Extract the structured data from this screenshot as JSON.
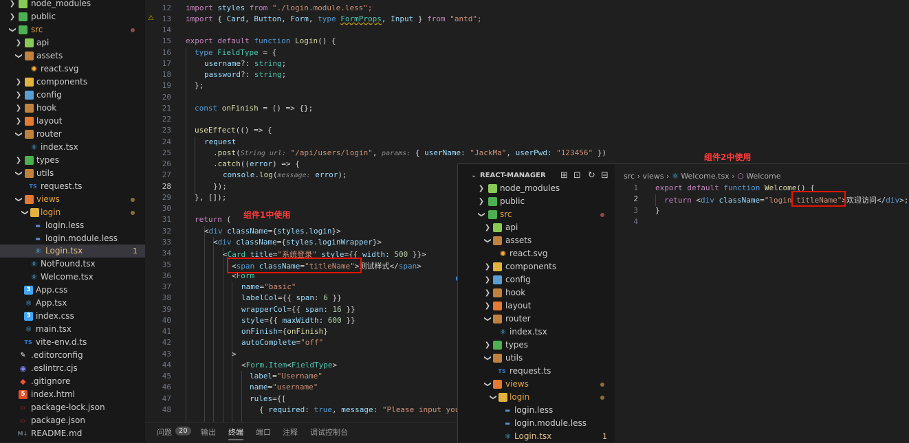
{
  "colors": {
    "folder_green": "#89c955",
    "folder_yellow": "#e2b23e",
    "folder_orange": "#e37933",
    "react_blue": "#4fc1ff",
    "ts_blue": "#3178c6",
    "css_blue": "#42a5f5",
    "modified_dot": "#8a6d3b",
    "annotation_red": "#e51400"
  },
  "explorer": {
    "items": [
      {
        "label": "node_modules",
        "icon": "folder-node-icon"
      },
      {
        "label": "public",
        "icon": "folder-public-icon"
      },
      {
        "label": "src",
        "icon": "folder-src-icon"
      },
      {
        "label": "api",
        "icon": "folder-api-icon"
      },
      {
        "label": "assets",
        "icon": "folder-assets-icon"
      },
      {
        "label": "react.svg",
        "icon": "svg-file-icon"
      },
      {
        "label": "components",
        "icon": "folder-components-icon"
      },
      {
        "label": "config",
        "icon": "folder-config-icon"
      },
      {
        "label": "hook",
        "icon": "folder-hook-icon"
      },
      {
        "label": "layout",
        "icon": "folder-layout-icon"
      },
      {
        "label": "router",
        "icon": "folder-router-icon"
      },
      {
        "label": "index.tsx",
        "icon": "react-file-icon"
      },
      {
        "label": "types",
        "icon": "folder-types-icon"
      },
      {
        "label": "utils",
        "icon": "folder-utils-icon"
      },
      {
        "label": "request.ts",
        "icon": "ts-file-icon"
      },
      {
        "label": "views",
        "icon": "folder-views-icon"
      },
      {
        "label": "login",
        "icon": "folder-login-icon"
      },
      {
        "label": "login.less",
        "icon": "less-file-icon"
      },
      {
        "label": "login.module.less",
        "icon": "less-file-icon"
      },
      {
        "label": "Login.tsx",
        "icon": "react-file-icon",
        "badge": "1"
      },
      {
        "label": "NotFound.tsx",
        "icon": "react-file-icon"
      },
      {
        "label": "Welcome.tsx",
        "icon": "react-file-icon"
      },
      {
        "label": "App.css",
        "icon": "css-file-icon"
      },
      {
        "label": "App.tsx",
        "icon": "react-file-icon"
      },
      {
        "label": "index.css",
        "icon": "css-file-icon"
      },
      {
        "label": "main.tsx",
        "icon": "react-file-icon"
      },
      {
        "label": "vite-env.d.ts",
        "icon": "ts-file-icon"
      },
      {
        "label": ".editorconfig",
        "icon": "editorconfig-icon"
      },
      {
        "label": ".eslintrc.cjs",
        "icon": "eslint-icon"
      },
      {
        "label": ".gitignore",
        "icon": "git-icon"
      },
      {
        "label": "index.html",
        "icon": "html-file-icon"
      },
      {
        "label": "package-lock.json",
        "icon": "npm-icon"
      },
      {
        "label": "package.json",
        "icon": "npm-icon"
      },
      {
        "label": "README.md",
        "icon": "markdown-icon"
      }
    ]
  },
  "editor": {
    "line_numbers": [
      "12",
      "13",
      "14",
      "15",
      "16",
      "17",
      "18",
      "19",
      "20",
      "21",
      "22",
      "23",
      "24",
      "25",
      "26",
      "27",
      "28",
      "29",
      "30",
      "31",
      "32",
      "33",
      "34",
      "35",
      "36",
      "37",
      "38",
      "39",
      "40",
      "41",
      "42",
      "43",
      "44",
      "45",
      "46",
      "47",
      "48"
    ],
    "warning_glyph": "⚠",
    "code": {
      "l12": {
        "a": "import",
        "b": " styles ",
        "c": "from",
        "d": " \"./login.module.less\";"
      },
      "l13": {
        "a": "import",
        "b": " { ",
        "c": "Card",
        "d": ", ",
        "e": "Button",
        "f": ", ",
        "g": "Form",
        "h": ", ",
        "i": "type",
        "j": " ",
        "k": "FormProps",
        "l": ", ",
        "m": "Input",
        "n": " } ",
        "o": "from",
        "p": " \"antd\";"
      },
      "l15": {
        "a": "export",
        "b": " ",
        "c": "default",
        "d": " ",
        "e": "function",
        "f": " ",
        "g": "Login",
        "h": "() {"
      },
      "l16": {
        "a": "type",
        "b": " ",
        "c": "FieldType",
        "d": " = {"
      },
      "l17": {
        "a": "username",
        "b": "?: ",
        "c": "string",
        "d": ";"
      },
      "l18": {
        "a": "password",
        "b": "?: ",
        "c": "string",
        "d": ";"
      },
      "l19": "};",
      "l21": {
        "a": "const",
        "b": " ",
        "c": "onFinish",
        "d": " = () => {};"
      },
      "l23": {
        "a": "useEffect",
        "b": "(() => {"
      },
      "l24": "request",
      "l25": {
        "a": ".",
        "b": "post",
        "c": "(",
        "d": "String url:",
        "e": " \"/api/users/login\"",
        "f": ", ",
        "g": "params:",
        "h": " { ",
        "i": "userName",
        "j": ": ",
        "k": "\"JackMa\"",
        "l": ", ",
        "m": "userPwd",
        "n": ": ",
        "o": "\"123456\"",
        "p": " })"
      },
      "l26": {
        "a": ".",
        "b": "catch",
        "c": "((",
        "d": "error",
        "e": ") => {"
      },
      "l27": {
        "a": "console",
        "b": ".",
        "c": "log",
        "d": "(",
        "e": "message:",
        "f": " ",
        "g": "error",
        "h": ");"
      },
      "l28": "});",
      "l29": "}, []);",
      "l31": {
        "a": "return",
        "b": " ("
      },
      "l32": {
        "a": "<",
        "b": "div",
        "c": " ",
        "d": "className",
        "e": "={",
        "f": "styles",
        "g": ".",
        "h": "login",
        "i": "}>"
      },
      "l33": {
        "a": "<",
        "b": "div",
        "c": " ",
        "d": "className",
        "e": "={",
        "f": "styles",
        "g": ".",
        "h": "loginWrapper",
        "i": "}>"
      },
      "l34": {
        "a": "<",
        "b": "Card",
        "c": " ",
        "d": "title",
        "e": "=",
        "f": "\"系统登录\"",
        "g": " ",
        "h": "style",
        "i": "={{ ",
        "j": "width",
        "k": ": ",
        "l": "500",
        "m": " }}>"
      },
      "l35": {
        "a": "<",
        "b": "span",
        "c": " ",
        "d": "className",
        "e": "=",
        "f": "\"titleName\"",
        "g": ">",
        "h": "测试样式",
        "i": "</",
        "j": "span",
        "k": ">"
      },
      "l36": {
        "a": "<",
        "b": "Form"
      },
      "l37": {
        "a": "name",
        "b": "=",
        "c": "\"basic\""
      },
      "l38": {
        "a": "labelCol",
        "b": "={{ ",
        "c": "span",
        "d": ": ",
        "e": "6",
        "f": " }}"
      },
      "l39": {
        "a": "wrapperCol",
        "b": "={{ ",
        "c": "span",
        "d": ": ",
        "e": "16",
        "f": " }}"
      },
      "l40": {
        "a": "style",
        "b": "={{ ",
        "c": "maxWidth",
        "d": ": ",
        "e": "600",
        "f": " }}"
      },
      "l41": {
        "a": "onFinish",
        "b": "={",
        "c": "onFinish",
        "d": "}"
      },
      "l42": {
        "a": "autoComplete",
        "b": "=",
        "c": "\"off\""
      },
      "l43": ">",
      "l44": {
        "a": "<",
        "b": "Form.Item",
        "c": "<",
        "d": "FieldType",
        "e": ">"
      },
      "l45": {
        "a": "label",
        "b": "=",
        "c": "\"Username\""
      },
      "l46": {
        "a": "name",
        "b": "=",
        "c": "\"username\""
      },
      "l47": {
        "a": "rules",
        "b": "={["
      },
      "l48": {
        "a": "{ ",
        "b": "required",
        "c": ": ",
        "d": "true",
        "e": ", ",
        "f": "message",
        "g": ": ",
        "h": "\"Please input you"
      }
    }
  },
  "annotations": {
    "component1": "组件1中使用",
    "component2": "组件2中使用"
  },
  "panel": {
    "tabs": [
      {
        "label": "问题"
      },
      {
        "label": "输出"
      },
      {
        "label": "终端"
      },
      {
        "label": "端口"
      },
      {
        "label": "注释"
      },
      {
        "label": "调试控制台"
      }
    ],
    "problems_count": "20"
  },
  "overlay": {
    "explorer_title": "REACT-MANAGER",
    "toolbar_icons": [
      "new-file-icon",
      "new-folder-icon",
      "refresh-icon",
      "collapse-all-icon"
    ],
    "items": [
      {
        "label": "node_modules"
      },
      {
        "label": "public"
      },
      {
        "label": "src"
      },
      {
        "label": "api"
      },
      {
        "label": "assets"
      },
      {
        "label": "react.svg"
      },
      {
        "label": "components"
      },
      {
        "label": "config"
      },
      {
        "label": "hook"
      },
      {
        "label": "layout"
      },
      {
        "label": "router"
      },
      {
        "label": "index.tsx"
      },
      {
        "label": "types"
      },
      {
        "label": "utils"
      },
      {
        "label": "request.ts"
      },
      {
        "label": "views"
      },
      {
        "label": "login"
      },
      {
        "label": "login.less"
      },
      {
        "label": "login.module.less"
      },
      {
        "label": "Login.tsx",
        "badge": "1"
      }
    ],
    "breadcrumb": [
      "src",
      "views",
      "Welcome.tsx",
      "Welcome"
    ],
    "line_numbers": [
      "1",
      "2",
      "3",
      "4"
    ],
    "code": {
      "l1": {
        "a": "export",
        "b": " ",
        "c": "default",
        "d": " ",
        "e": "function",
        "f": " ",
        "g": "Welcome",
        "h": "() {"
      },
      "l2": {
        "a": "return",
        "b": " ",
        "c": "<",
        "d": "div",
        "e": " ",
        "f": "className",
        "g": "=",
        "h": "\"login ",
        "i": "titleName\"",
        "j": ">",
        "k": "欢迎访问",
        "l": "</",
        "m": "div",
        "n": ">;"
      },
      "l3": "}"
    }
  }
}
